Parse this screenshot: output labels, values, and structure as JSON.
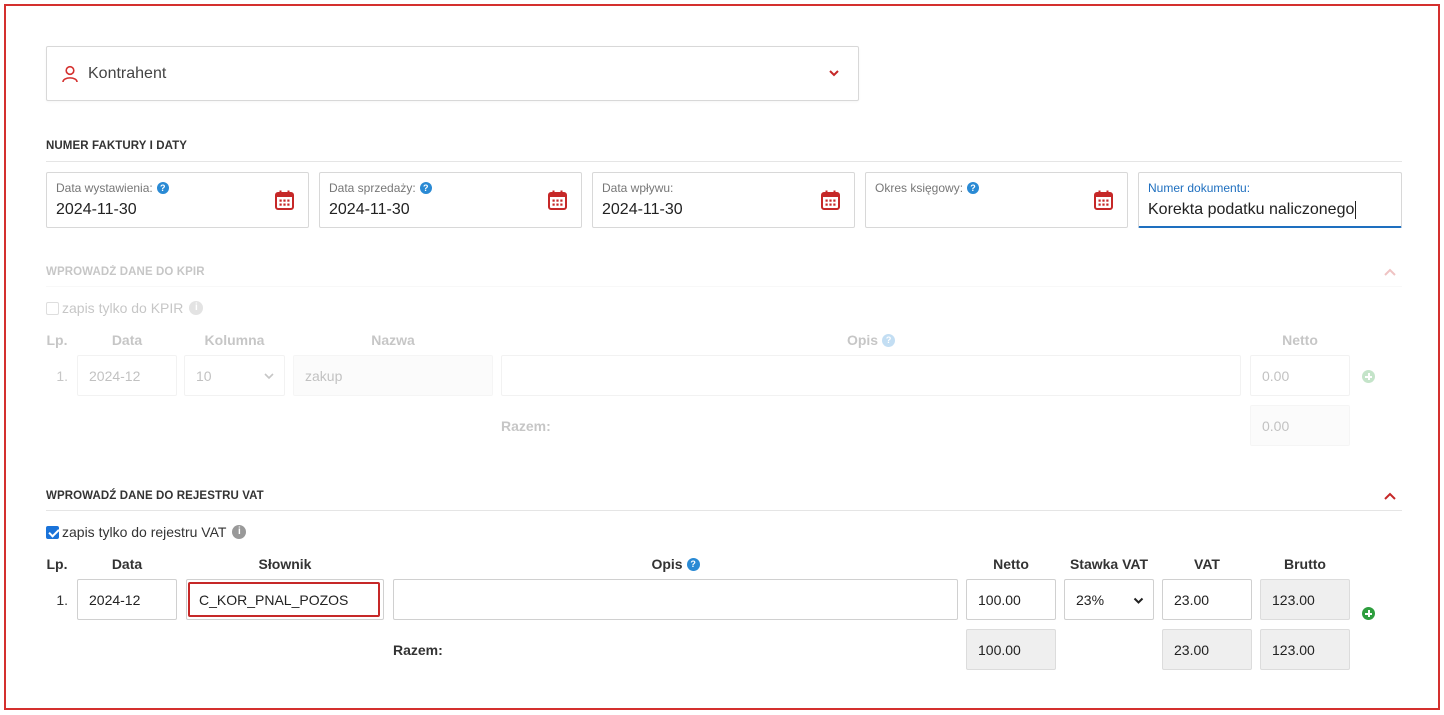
{
  "contractor": {
    "label": "Kontrahent"
  },
  "invoice_section": {
    "title": "NUMER FAKTURY I DATY",
    "fields": [
      {
        "label": "Data wystawienia:",
        "value": "2024-11-30"
      },
      {
        "label": "Data sprzedaży:",
        "value": "2024-11-30"
      },
      {
        "label": "Data wpływu:",
        "value": "2024-11-30"
      },
      {
        "label": "Okres księgowy:",
        "value": ""
      }
    ],
    "document_number": {
      "label": "Numer dokumentu:",
      "value": "Korekta podatku naliczonego"
    }
  },
  "kpir": {
    "title": "WPROWADŹ DANE DO KPIR",
    "checkbox_label": "zapis tylko do KPIR",
    "headers": {
      "lp": "Lp.",
      "date": "Data",
      "column": "Kolumna",
      "name": "Nazwa",
      "desc": "Opis",
      "net": "Netto"
    },
    "row": {
      "lp": "1.",
      "date": "2024-12",
      "column": "10",
      "name": "zakup",
      "desc": "",
      "net": "0.00"
    },
    "total_label": "Razem:",
    "total_net": "0.00"
  },
  "vat": {
    "title": "WPROWADŹ DANE DO REJESTRU VAT",
    "checkbox_label": "zapis tylko do rejestru VAT",
    "checked": true,
    "headers": {
      "lp": "Lp.",
      "date": "Data",
      "dict": "Słownik",
      "desc": "Opis",
      "net": "Netto",
      "rate": "Stawka VAT",
      "vat": "VAT",
      "gross": "Brutto"
    },
    "row": {
      "lp": "1.",
      "date": "2024-12",
      "dict": "C_KOR_PNAL_POZOS",
      "desc": "",
      "net": "100.00",
      "rate": "23%",
      "vat": "23.00",
      "gross": "123.00"
    },
    "total_label": "Razem:",
    "totals": {
      "net": "100.00",
      "vat": "23.00",
      "gross": "123.00"
    }
  },
  "colors": {
    "accent": "#d4302e",
    "link_blue": "#1e6fbf",
    "help_blue": "#2a8ad4",
    "add_green": "#2e9e3e"
  }
}
